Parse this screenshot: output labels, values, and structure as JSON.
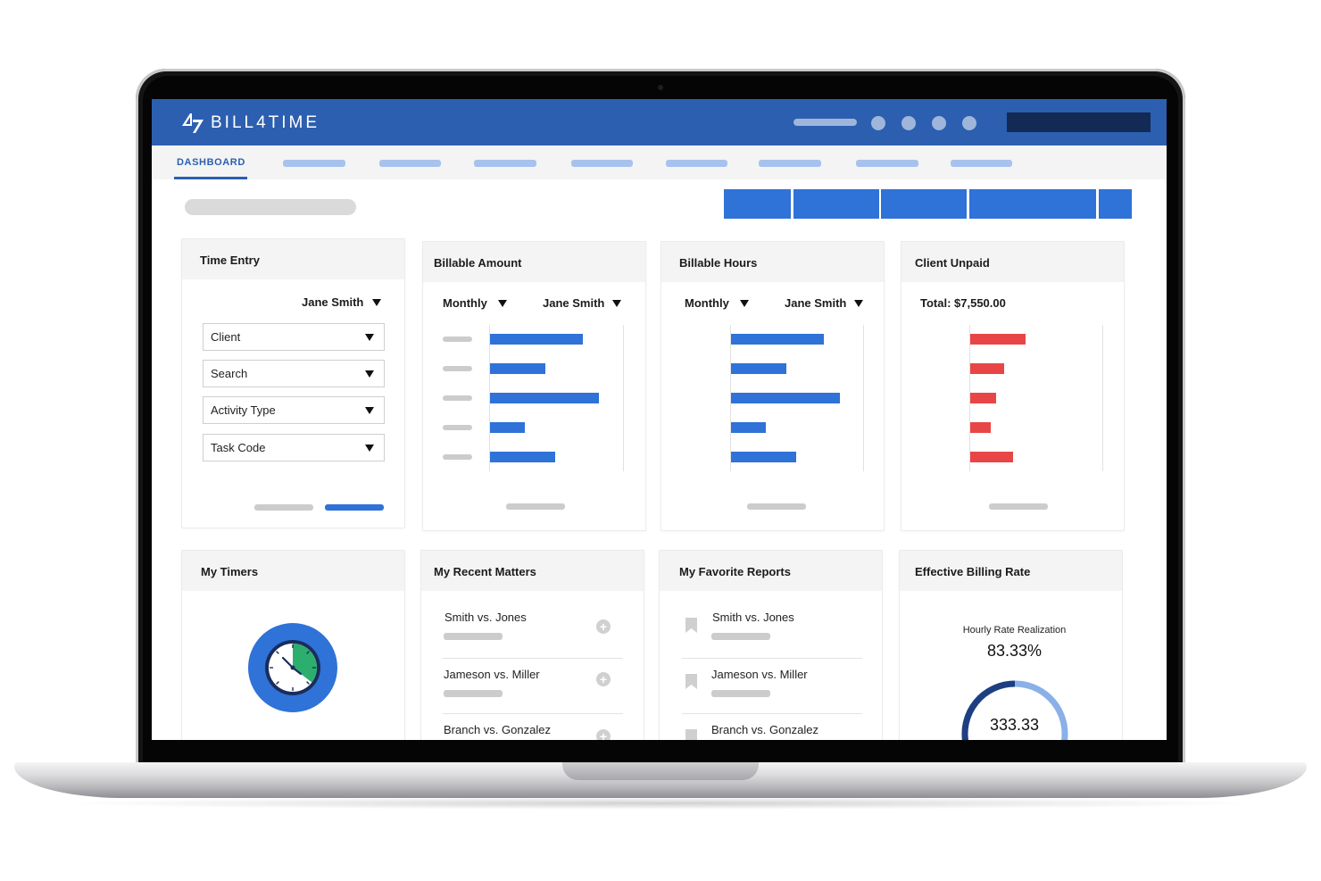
{
  "app": {
    "name": "BILL4TIME"
  },
  "nav": {
    "active_tab": "DASHBOARD"
  },
  "cards": {
    "time_entry": {
      "title": "Time Entry",
      "user": "Jane Smith",
      "dropdowns": [
        "Client",
        "Search",
        "Activity Type",
        "Task Code"
      ]
    },
    "billable_amount": {
      "title": "Billable Amount",
      "period": "Monthly",
      "user": "Jane Smith"
    },
    "billable_hours": {
      "title": "Billable Hours",
      "period": "Monthly",
      "user": "Jane Smith"
    },
    "client_unpaid": {
      "title": "Client Unpaid",
      "total": "Total: $7,550.00"
    },
    "my_timers": {
      "title": "My Timers"
    },
    "recent_matters": {
      "title": "My Recent Matters",
      "items": [
        "Smith vs. Jones",
        "Jameson vs. Miller",
        "Branch vs. Gonzalez"
      ]
    },
    "favorite_reports": {
      "title": "My Favorite Reports",
      "items": [
        "Smith vs. Jones",
        "Jameson vs. Miller",
        "Branch vs. Gonzalez"
      ]
    },
    "billing_rate": {
      "title": "Effective Billing Rate",
      "subtitle": "Hourly Rate Realization",
      "percent": "83.33%",
      "value": "333.33",
      "gauge_fraction": 0.8333
    }
  },
  "chart_data": [
    {
      "type": "bar",
      "name": "Billable Amount",
      "orientation": "horizontal",
      "values": [
        0.72,
        0.43,
        0.84,
        0.27,
        0.5
      ],
      "color": "#2f72d8"
    },
    {
      "type": "bar",
      "name": "Billable Hours",
      "orientation": "horizontal",
      "values": [
        0.72,
        0.43,
        0.84,
        0.27,
        0.5
      ],
      "color": "#2f72d8"
    },
    {
      "type": "bar",
      "name": "Client Unpaid",
      "orientation": "horizontal",
      "values": [
        0.43,
        0.26,
        0.2,
        0.16,
        0.33
      ],
      "color": "#e84646"
    }
  ],
  "colors": {
    "brand": "#2c5fb0",
    "accent": "#2f72d8",
    "danger": "#e84646",
    "timer_green": "#2cae6e",
    "navy": "#132a55"
  },
  "icons": [
    "logo-mark-icon",
    "dropdown-arrow-icon",
    "plus-circle-icon",
    "bookmark-icon",
    "clock-icon"
  ]
}
